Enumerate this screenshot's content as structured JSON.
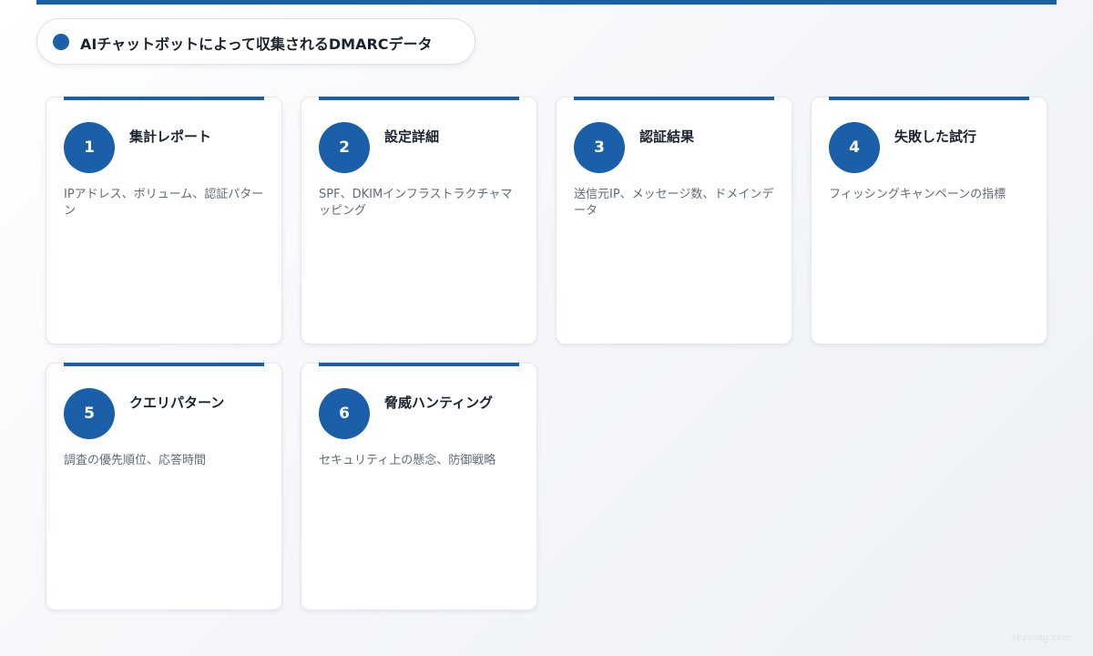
{
  "header": {
    "title": "AIチャットボットによって収集されるDMARCデータ",
    "accent_color": "#1a5fa8"
  },
  "cards": [
    {
      "number": "1",
      "title": "集計レポート",
      "description": "IPアドレス、ボリューム、認証パターン"
    },
    {
      "number": "2",
      "title": "設定詳細",
      "description": "SPF、DKIMインフラストラクチャマッピング"
    },
    {
      "number": "3",
      "title": "認証結果",
      "description": "送信元IP、メッセージ数、ドメインデータ"
    },
    {
      "number": "4",
      "title": "失敗した試行",
      "description": "フィッシングキャンペーンの指標"
    },
    {
      "number": "5",
      "title": "クエリパターン",
      "description": "調査の優先順位、応答時間"
    },
    {
      "number": "6",
      "title": "脅威ハンティング",
      "description": "セキュリティ上の懸念、防御戦略"
    }
  ],
  "watermark": "skysnag.com"
}
